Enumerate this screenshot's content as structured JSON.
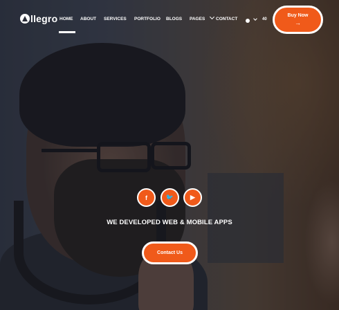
{
  "brand": {
    "logo_text": "llegro",
    "logo_icon": "triangle-a-icon"
  },
  "nav": {
    "items": [
      {
        "label": "HOME",
        "active": true
      },
      {
        "label": "ABOUT"
      },
      {
        "label": "SERVICES"
      },
      {
        "label": "PORTFOLIO"
      },
      {
        "label": "BLOGS"
      },
      {
        "label": "PAGES"
      },
      {
        "label": "CONTACT"
      }
    ],
    "language": "40"
  },
  "buy_button": {
    "label": "Buy Now",
    "icon": "arrow-right-icon"
  },
  "hero": {
    "social": [
      {
        "glyph": "f",
        "icon": "facebook-icon"
      },
      {
        "glyph": "🐦",
        "icon": "twitter-icon"
      },
      {
        "glyph": "▶",
        "icon": "youtube-icon"
      }
    ],
    "tagline": "WE DEVELOPED WEB & MOBILE APPS",
    "cta_label": "Contact Us"
  },
  "colors": {
    "accent": "#f05a1a",
    "text": "#ffffff"
  }
}
